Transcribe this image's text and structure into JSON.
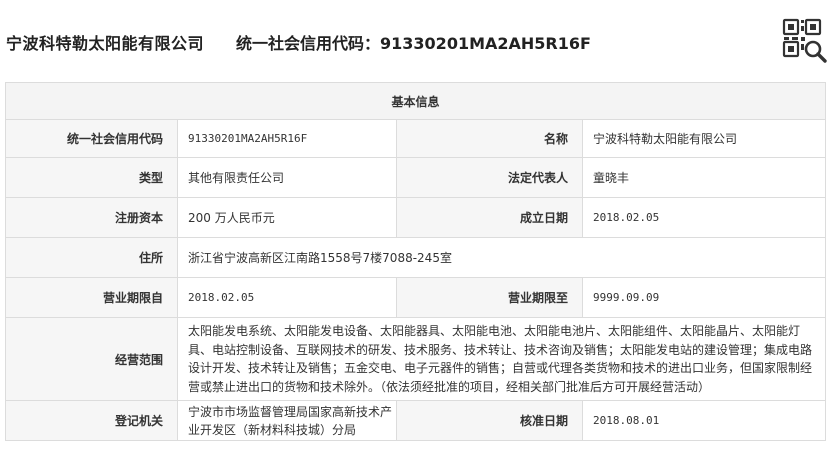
{
  "header": {
    "company_name": "宁波科特勒太阳能有限公司",
    "credit_code_label": "统一社会信用代码：",
    "credit_code": "91330201MA2AH5R16F"
  },
  "icons": {
    "qr": "qr-code-search-icon"
  },
  "table": {
    "section_title": "基本信息",
    "rows": {
      "credit_code": {
        "label": "统一社会信用代码",
        "value": "91330201MA2AH5R16F"
      },
      "name": {
        "label": "名称",
        "value": "宁波科特勒太阳能有限公司"
      },
      "type": {
        "label": "类型",
        "value": "其他有限责任公司"
      },
      "legal_rep": {
        "label": "法定代表人",
        "value": "童晓丰"
      },
      "capital": {
        "label": "注册资本",
        "value": "200 万人民币元"
      },
      "founded": {
        "label": "成立日期",
        "value": "2018.02.05"
      },
      "address": {
        "label": "住所",
        "value": "浙江省宁波高新区江南路1558号7楼7088-245室"
      },
      "term_from": {
        "label": "营业期限自",
        "value": "2018.02.05"
      },
      "term_to": {
        "label": "营业期限至",
        "value": "9999.09.09"
      },
      "scope": {
        "label": "经营范围",
        "value": "太阳能发电系统、太阳能发电设备、太阳能器具、太阳能电池、太阳能电池片、太阳能组件、太阳能晶片、太阳能灯具、电站控制设备、互联网技术的研发、技术服务、技术转让、技术咨询及销售；太阳能发电站的建设管理；集成电路设计开发、技术转让及销售；五金交电、电子元器件的销售；自营或代理各类货物和技术的进出口业务，但国家限制经营或禁止进出口的货物和技术除外。（依法须经批准的项目，经相关部门批准后方可开展经营活动）"
      },
      "authority": {
        "label": "登记机关",
        "value": "宁波市市场监督管理局国家高新技术产业开发区（新材料科技城）分局"
      },
      "approval": {
        "label": "核准日期",
        "value": "2018.08.01"
      }
    }
  }
}
